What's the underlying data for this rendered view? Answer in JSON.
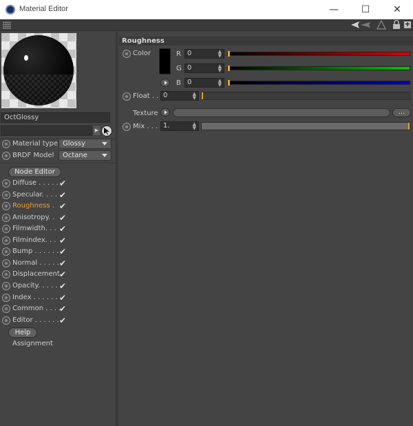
{
  "window": {
    "title": "Material Editor",
    "min": "—",
    "max": "☐",
    "close": "✕"
  },
  "material": {
    "name": "OctGlossy"
  },
  "params": [
    {
      "label": "Material type",
      "value": "Glossy"
    },
    {
      "label": "BRDF Model",
      "value": "Octane"
    }
  ],
  "node_editor_label": "Node Editor",
  "channels": [
    {
      "label": "Diffuse . . . . .",
      "checked": true
    },
    {
      "label": "Specular. . . . .",
      "checked": true
    },
    {
      "label": "Roughness .",
      "checked": true
    },
    {
      "label": "Anisotropy. .",
      "checked": true
    },
    {
      "label": "Filmwidth. . .",
      "checked": true
    },
    {
      "label": "Filmindex. . .",
      "checked": true
    },
    {
      "label": "Bump . . . . . .",
      "checked": true
    },
    {
      "label": "Normal . . . . .",
      "checked": true
    },
    {
      "label": "Displacement",
      "checked": true
    },
    {
      "label": "Opacity. . . . .",
      "checked": true
    },
    {
      "label": "Index . . . . . .",
      "checked": true
    },
    {
      "label": "Common . . . .",
      "checked": true
    },
    {
      "label": "Editor . . . . . .",
      "checked": true
    }
  ],
  "check_glyph": "✔",
  "help_label": "Help",
  "assignment_label": "Assignment",
  "section": {
    "title": "Roughness",
    "color_label": "Color",
    "r_label": "R",
    "r_value": "0",
    "g_label": "G",
    "g_value": "0",
    "b_label": "B",
    "b_value": "0",
    "float_label": "Float . .",
    "float_value": "0",
    "texture_label": "Texture",
    "texture_dots": "...",
    "mix_label": "Mix . . .",
    "mix_value": "1."
  },
  "colors": {
    "accent": "#f0a030",
    "panel": "#444444",
    "red": "#e00000",
    "green": "#00c000",
    "blue": "#0000d0"
  }
}
